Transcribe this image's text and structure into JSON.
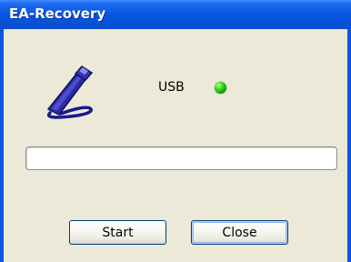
{
  "window": {
    "title": "EA-Recovery"
  },
  "status": {
    "usb_label": "USB",
    "usb_connected": true,
    "led_color": "#22cc11"
  },
  "icons": {
    "usb_device": "usb-plug-icon"
  },
  "progress": {
    "value": 0
  },
  "buttons": {
    "start": "Start",
    "close": "Close"
  }
}
